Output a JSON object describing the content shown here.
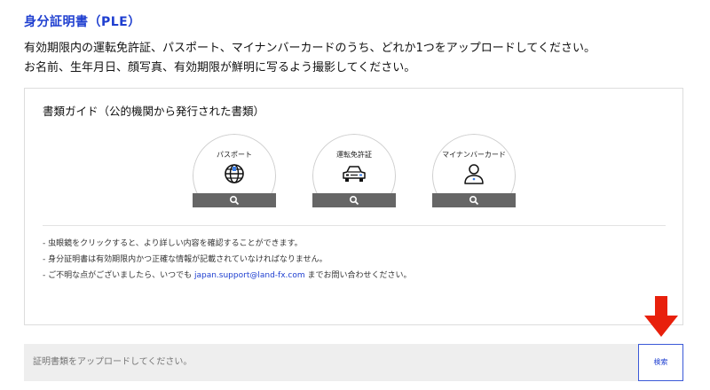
{
  "page": {
    "title": "身分証明書（PLE）",
    "intro_line1": "有効期限内の運転免許証、パスポート、マイナンバーカードのうち、どれか1つをアップロードしてください。",
    "intro_line2": "お名前、生年月日、顔写真、有効期限が鮮明に写るよう撮影してください。"
  },
  "guide": {
    "title": "書類ガイド（公的機関から発行された書類）",
    "documents": [
      {
        "label": "パスポート",
        "icon": "globe-icon"
      },
      {
        "label": "運転免許証",
        "icon": "car-icon"
      },
      {
        "label": "マイナンバーカード",
        "icon": "person-icon"
      }
    ],
    "notes": {
      "line1": "- 虫眼鏡をクリックすると、より詳しい内容を確認することができます。",
      "line2": "- 身分証明書は有効期限内かつ正確な情報が記載されていなければなりません。",
      "line3_prefix": "- ご不明な点がございましたら、いつでも ",
      "line3_email": "japan.support@land-fx.com",
      "line3_suffix": " までお問い合わせください。"
    }
  },
  "upload": {
    "placeholder": "証明書類をアップロードしてください。",
    "button_label": "検索"
  },
  "colors": {
    "accent": "#1f3fd0",
    "arrow": "#e8200c",
    "magnifier_bar": "#666666"
  }
}
